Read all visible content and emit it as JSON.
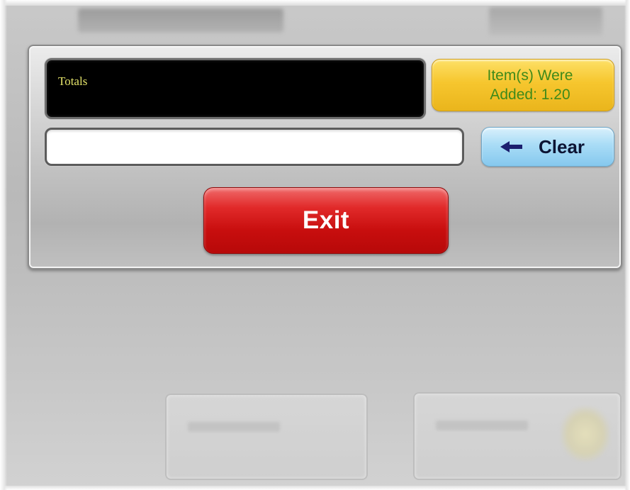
{
  "display": {
    "totals_label": "Totals"
  },
  "status": {
    "line1": "Item(s)  Were",
    "line2": "Added: 1.20",
    "text_color": "#3f8a1a",
    "background_color": "#f6c62e"
  },
  "entry": {
    "value": ""
  },
  "clear_button": {
    "label": "Clear",
    "icon": "arrow-left-icon",
    "color": "#a9dcf6"
  },
  "exit_button": {
    "label": "Exit",
    "color": "#d11616"
  }
}
